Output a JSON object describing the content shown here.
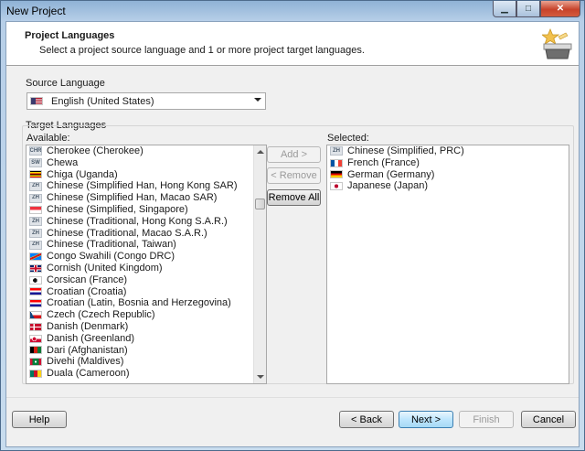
{
  "window": {
    "title": "New Project"
  },
  "header": {
    "title": "Project Languages",
    "subtitle": "Select a project source language and 1 or more project target languages."
  },
  "source": {
    "label": "Source Language",
    "selected": {
      "label": "English (United States)",
      "flag": "us"
    }
  },
  "target": {
    "group_label": "Target Languages",
    "available_label": "Available:",
    "selected_label": "Selected:",
    "available": [
      {
        "label": "Cherokee (Cherokee)",
        "flag": "code",
        "code": "CHR"
      },
      {
        "label": "Chewa",
        "flag": "code",
        "code": "SW"
      },
      {
        "label": "Chiga (Uganda)",
        "flag": "ug"
      },
      {
        "label": "Chinese (Simplified Han, Hong Kong SAR)",
        "flag": "code",
        "code": "ZH"
      },
      {
        "label": "Chinese (Simplified Han, Macao SAR)",
        "flag": "code",
        "code": "ZH"
      },
      {
        "label": "Chinese (Simplified, Singapore)",
        "flag": "sg"
      },
      {
        "label": "Chinese (Traditional, Hong Kong S.A.R.)",
        "flag": "code",
        "code": "ZH"
      },
      {
        "label": "Chinese (Traditional, Macao S.A.R.)",
        "flag": "code",
        "code": "ZH"
      },
      {
        "label": "Chinese (Traditional, Taiwan)",
        "flag": "code",
        "code": "ZH"
      },
      {
        "label": "Congo Swahili (Congo DRC)",
        "flag": "cd"
      },
      {
        "label": "Cornish (United Kingdom)",
        "flag": "gb"
      },
      {
        "label": "Corsican (France)",
        "flag": "corsica"
      },
      {
        "label": "Croatian (Croatia)",
        "flag": "hr"
      },
      {
        "label": "Croatian (Latin, Bosnia and Herzegovina)",
        "flag": "hr"
      },
      {
        "label": "Czech (Czech Republic)",
        "flag": "cz"
      },
      {
        "label": "Danish (Denmark)",
        "flag": "dk"
      },
      {
        "label": "Danish (Greenland)",
        "flag": "gl"
      },
      {
        "label": "Dari (Afghanistan)",
        "flag": "af"
      },
      {
        "label": "Divehi (Maldives)",
        "flag": "mv"
      },
      {
        "label": "Duala (Cameroon)",
        "flag": "cm"
      }
    ],
    "selected": [
      {
        "label": "Chinese (Simplified, PRC)",
        "flag": "code",
        "code": "ZH"
      },
      {
        "label": "French (France)",
        "flag": "fr"
      },
      {
        "label": "German (Germany)",
        "flag": "de"
      },
      {
        "label": "Japanese (Japan)",
        "flag": "jp"
      }
    ],
    "scroll_position": 0.2
  },
  "buttons": {
    "add": "Add >",
    "remove": "< Remove",
    "remove_all": "Remove All",
    "help": "Help",
    "back": "< Back",
    "next": "Next >",
    "finish": "Finish",
    "cancel": "Cancel"
  },
  "colors": {
    "accent": "#3c7fb1",
    "title_bar": "#8fb2d6"
  }
}
